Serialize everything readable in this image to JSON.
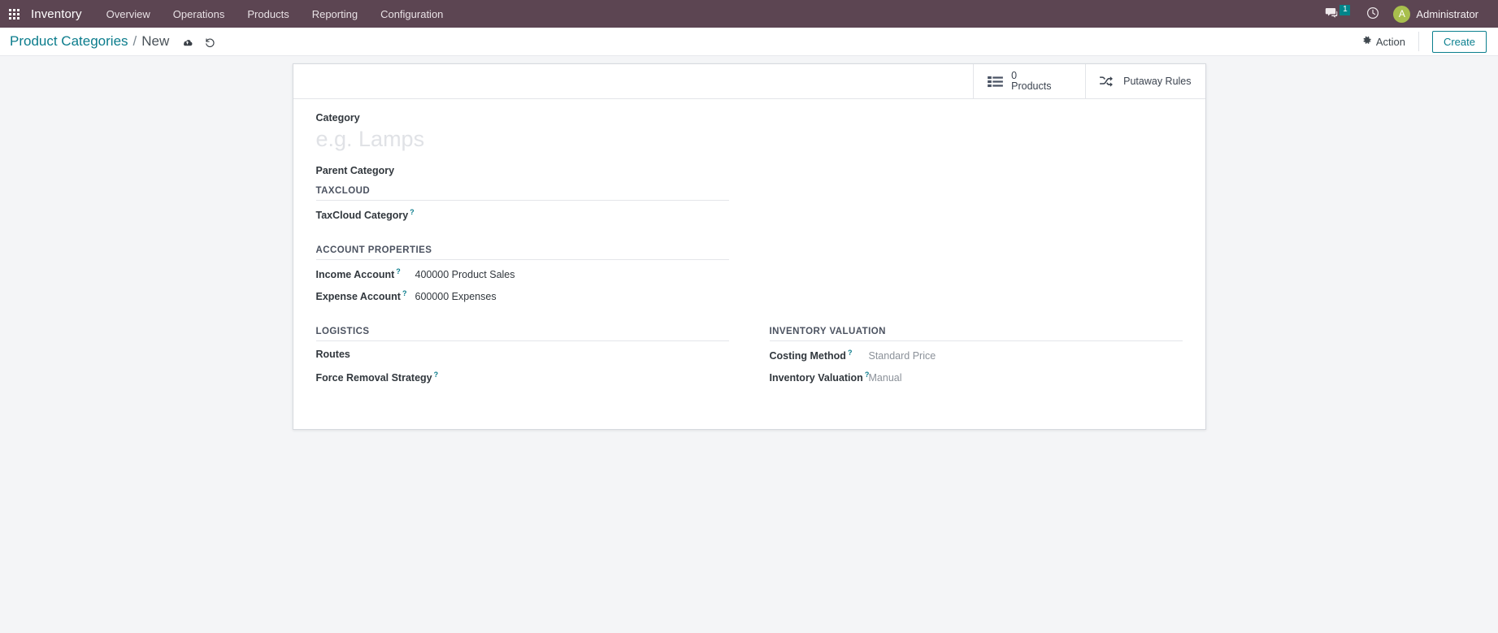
{
  "navbar": {
    "apps_icon": "apps-grid-icon",
    "brand": "Inventory",
    "menu": [
      {
        "label": "Overview"
      },
      {
        "label": "Operations"
      },
      {
        "label": "Products"
      },
      {
        "label": "Reporting"
      },
      {
        "label": "Configuration"
      }
    ],
    "messages_icon": "chat-bubble-icon",
    "messages_count": "1",
    "activities_icon": "clock-icon",
    "avatar_initial": "A",
    "user_name": "Administrator",
    "bg_color": "#5c4552",
    "badge_color": "#00858a",
    "avatar_color": "#a8bf4d"
  },
  "control_panel": {
    "breadcrumb_root": "Product Categories",
    "breadcrumb_separator": "/",
    "breadcrumb_current": "New",
    "save_icon": "cloud-upload-icon",
    "discard_icon": "undo-icon",
    "action_icon": "gear-icon",
    "action_label": "Action",
    "create_label": "Create",
    "accent_color": "#0a7f8e"
  },
  "stat_buttons": [
    {
      "icon": "list-ul-icon",
      "value": "0",
      "label": "Products"
    },
    {
      "icon": "random-shuffle-icon",
      "label": "Putaway Rules"
    }
  ],
  "form": {
    "category_label": "Category",
    "category_value": "",
    "category_placeholder": "e.g. Lamps",
    "parent_category_label": "Parent Category",
    "parent_category_value": "",
    "groups": {
      "taxcloud": {
        "title": "TAXCLOUD",
        "fields": [
          {
            "label": "TaxCloud Category",
            "help": "?",
            "value": ""
          }
        ]
      },
      "account_properties": {
        "title": "ACCOUNT PROPERTIES",
        "fields": [
          {
            "label": "Income Account",
            "help": "?",
            "value": "400000 Product Sales"
          },
          {
            "label": "Expense Account",
            "help": "?",
            "value": "600000 Expenses"
          }
        ]
      },
      "logistics": {
        "title": "LOGISTICS",
        "fields": [
          {
            "label": "Routes",
            "help": "",
            "value": ""
          },
          {
            "label": "Force Removal Strategy",
            "help": "?",
            "value": ""
          }
        ]
      },
      "inventory_valuation": {
        "title": "INVENTORY VALUATION",
        "fields": [
          {
            "label": "Costing Method",
            "help": "?",
            "value": "Standard Price"
          },
          {
            "label": "Inventory Valuation",
            "help": "?",
            "value": "Manual"
          }
        ]
      }
    }
  }
}
